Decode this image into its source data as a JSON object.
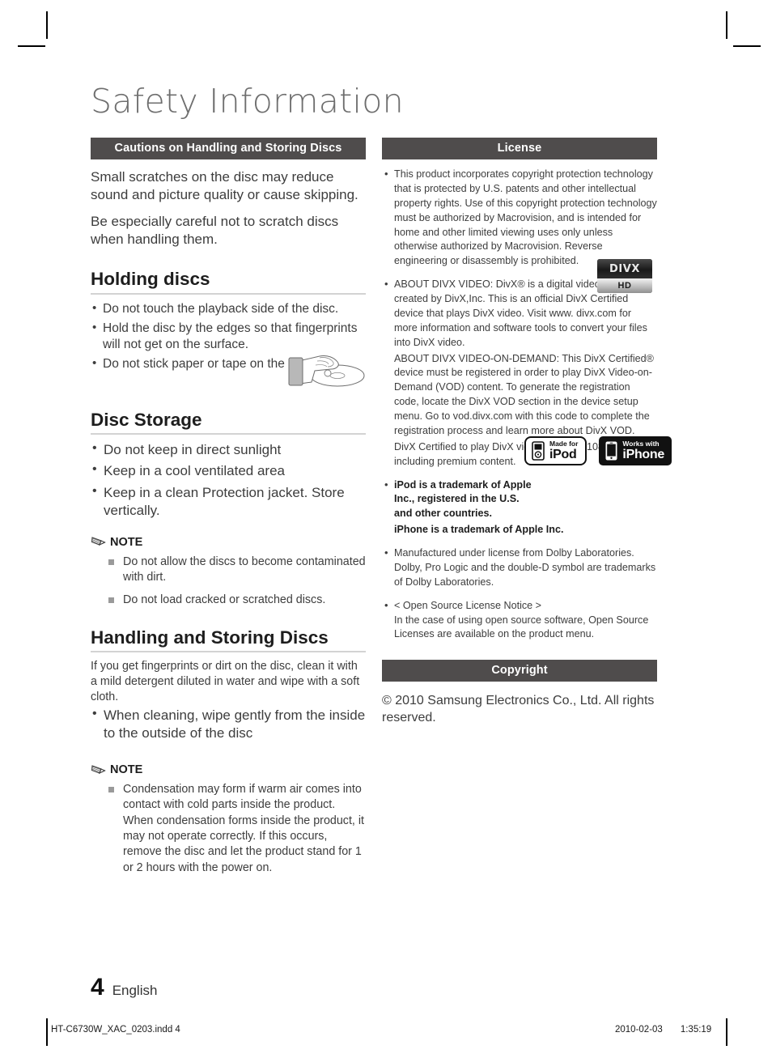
{
  "document": {
    "title": "Safety Information"
  },
  "left_column": {
    "section_header": "Cautions on Handling and Storing Discs",
    "intro_paragraphs": [
      "Small scratches on the disc may reduce sound and picture quality or cause skipping.",
      "Be especially careful not to scratch discs when handling them."
    ],
    "holding_discs": {
      "heading": "Holding discs",
      "bullets": [
        "Do not touch the playback side of the disc.",
        "Hold the disc by the edges so that fingerprints will not get on the surface.",
        "Do not stick paper or tape on the disc."
      ]
    },
    "disc_storage": {
      "heading": "Disc Storage",
      "bullets": [
        "Do not keep in direct sunlight",
        "Keep in a cool ventilated area",
        "Keep in a clean Protection jacket. Store vertically."
      ]
    },
    "note_one": {
      "label": "NOTE",
      "items": [
        "Do not allow the discs to become contaminated with dirt.",
        "Do not load cracked or scratched discs."
      ]
    },
    "handling_storing": {
      "heading": "Handling and Storing Discs",
      "paragraph": "If you get fingerprints or dirt on the disc, clean it with a mild detergent diluted in water and wipe with a soft cloth.",
      "bullets": [
        "When cleaning, wipe gently from the inside to the outside of the disc"
      ]
    },
    "note_two": {
      "label": "NOTE",
      "items": [
        "Condensation may form if warm air comes into contact with cold parts inside the product. When condensation forms inside the product, it may not operate correctly. If this occurs, remove the disc and let the product stand for 1 or 2 hours with the power on."
      ]
    }
  },
  "right_column": {
    "license_header": "License",
    "license_bullets": [
      "This product incorporates copyright protection technology that is protected by U.S. patents and other intellectual property rights. Use of this copyright protection technology must be authorized by Macrovision, and is intended for home and other limited viewing uses only unless otherwise authorized by Macrovision. Reverse engineering or disassembly is prohibited."
    ],
    "divx": {
      "para1": "ABOUT DIVX VIDEO: DivX® is a digital video format created by DivX,Inc. This is an official DivX Certified device that plays DivX video. Visit www. divx.com for more information and software tools to convert your files into DivX video.",
      "para2": "ABOUT DIVX VIDEO-ON-DEMAND: This DivX Certified® device must be registered in order to play DivX Video-on-Demand (VOD) content. To generate the registration code, locate the DivX VOD section in the device setup menu. Go to vod.divx.com with this code to complete the registration process and learn more about DivX VOD.",
      "para3": "DivX Certified to play DivX video up to HD 1080p, including premium content.",
      "logo_top": "DIVX",
      "logo_bottom": "HD"
    },
    "apple": {
      "para1": "iPod is a trademark of Apple Inc., registered in the U.S. and other countries.",
      "para2": "iPhone is a trademark of Apple Inc.",
      "badge_ipod_small": "Made for",
      "badge_ipod_big": "iPod",
      "badge_iphone_small": "Works with",
      "badge_iphone_big": "iPhone"
    },
    "dolby": "Manufactured under license from Dolby Laboratories. Dolby, Pro Logic and the double-D symbol are trademarks of Dolby Laboratories.",
    "open_source": {
      "title": "< Open Source License Notice >",
      "body": "In the case of using open source software, Open Source Licenses are available on the product menu."
    },
    "copyright_header": "Copyright",
    "copyright_text": "© 2010 Samsung Electronics Co., Ltd. All rights reserved."
  },
  "footer": {
    "page_number": "4",
    "language": "English",
    "file_name": "HT-C6730W_XAC_0203.indd   4",
    "date": "2010-02-03",
    "time": "1:35:19"
  },
  "colors": {
    "header_bar": "#4f4c4c",
    "title_gray": "#6e6e6e",
    "body_gray": "#3d3d3d",
    "rule_gray": "#d3d3d3"
  }
}
